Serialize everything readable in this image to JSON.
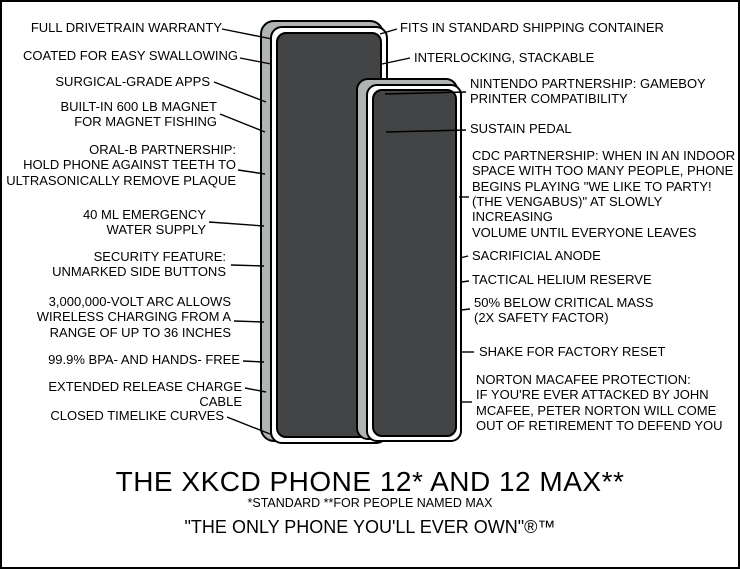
{
  "title": {
    "main": "The xkcd Phone 12* and 12 Max**",
    "notes": "*Standard   **For people named Max",
    "tagline": "\"The only phone you'll ever own\"®™"
  },
  "left_labels": [
    {
      "id": "l1",
      "text": "Full drivetrain warranty"
    },
    {
      "id": "l2",
      "text": "Coated for easy swallowing"
    },
    {
      "id": "l3",
      "text": "Surgical-grade apps"
    },
    {
      "id": "l4",
      "text": "Built-in 600 lb magnet\nfor magnet fishing"
    },
    {
      "id": "l5",
      "text": "Oral-B partnership:\nhold phone against teeth to\nultrasonically remove plaque"
    },
    {
      "id": "l6",
      "text": "40 mL emergency\nwater supply"
    },
    {
      "id": "l7",
      "text": "Security feature:\nunmarked side buttons"
    },
    {
      "id": "l8",
      "text": "3,000,000-volt arc allows\nwireless charging from a\nrange of up to 36 inches"
    },
    {
      "id": "l9",
      "text": "99.9% BPA- and hands- free"
    },
    {
      "id": "l10",
      "text": "Extended release charge cable"
    },
    {
      "id": "l11",
      "text": "Closed timelike curves"
    }
  ],
  "right_labels": [
    {
      "id": "r1",
      "text": "Fits in standard shipping container"
    },
    {
      "id": "r2",
      "text": "Interlocking, stackable"
    },
    {
      "id": "r3",
      "text": "Nintendo partnership: GameBoy\nPrinter compatibility"
    },
    {
      "id": "r4",
      "text": "Sustain pedal"
    },
    {
      "id": "r5",
      "text": "CDC partnership: when in an indoor\nspace with too many people, phone\nbegins playing \"We Like to Party!\n(The Vengabus)\" at slowly increasing\nvolume until everyone leaves"
    },
    {
      "id": "r6",
      "text": "Sacrificial anode"
    },
    {
      "id": "r7",
      "text": "Tactical helium reserve"
    },
    {
      "id": "r8",
      "text": "50% below critical mass\n(2x safety factor)"
    },
    {
      "id": "r9",
      "text": "Shake for factory reset"
    },
    {
      "id": "r10",
      "text": "Norton MacAfee protection:\nIf you're ever attacked by John\nMcAfee, Peter Norton will come\nout of retirement to defend you"
    }
  ]
}
